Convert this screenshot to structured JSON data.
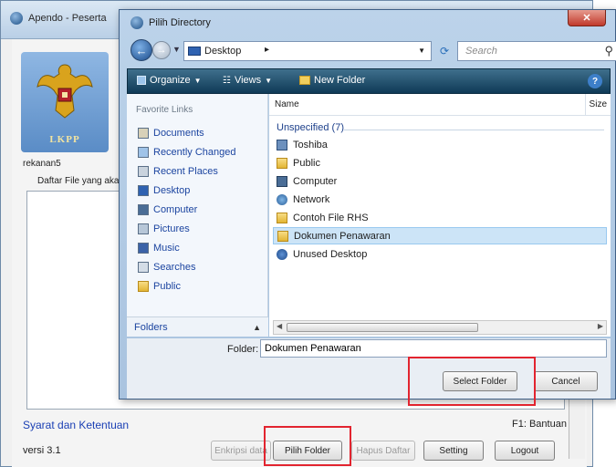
{
  "background_app": {
    "title": "Apendo - Peserta",
    "logo_text": "LKPP",
    "user_label": "rekanan5",
    "files_label": "Daftar File yang akan",
    "terms_link": "Syarat dan Ketentuan",
    "help_text": "F1: Bantuan",
    "version": "versi 3.1",
    "buttons": {
      "encrypt": "Enkripsi data",
      "choose_folder": "Pilih Folder",
      "delete_list": "Hapus Daftar",
      "setting": "Setting",
      "logout": "Logout"
    }
  },
  "dialog": {
    "title": "Pilih Directory",
    "address": "Desktop",
    "search_placeholder": "Search",
    "toolbar": {
      "organize": "Organize",
      "views": "Views",
      "new_folder": "New Folder"
    },
    "nav": {
      "section_title": "Favorite Links",
      "items": [
        "Documents",
        "Recently Changed",
        "Recent Places",
        "Desktop",
        "Computer",
        "Pictures",
        "Music",
        "Searches",
        "Public"
      ],
      "folders_label": "Folders"
    },
    "list": {
      "columns": {
        "name": "Name",
        "size": "Size"
      },
      "group_title": "Unspecified (7)",
      "items": [
        {
          "label": "Toshiba",
          "icon": "user-folder-icon"
        },
        {
          "label": "Public",
          "icon": "folder-icon"
        },
        {
          "label": "Computer",
          "icon": "computer-icon"
        },
        {
          "label": "Network",
          "icon": "network-icon"
        },
        {
          "label": "Contoh File RHS",
          "icon": "folder-icon"
        },
        {
          "label": "Dokumen Penawaran",
          "icon": "folder-icon",
          "selected": true
        },
        {
          "label": "Unused Desktop",
          "icon": "shortcut-icon"
        }
      ]
    },
    "folder_label": "Folder:",
    "folder_value": "Dokumen Penawaran",
    "select_button": "Select Folder",
    "cancel_button": "Cancel",
    "close_glyph": "✕"
  },
  "colors": {
    "highlight": "#e2242f",
    "command_bar": "#1b4a68",
    "link": "#1c45a0"
  }
}
